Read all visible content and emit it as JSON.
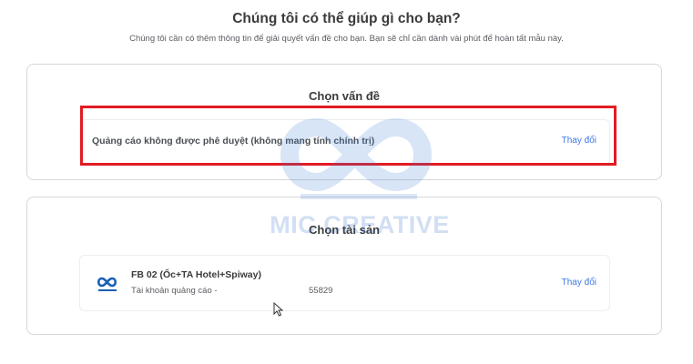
{
  "header": {
    "title": "Chúng tôi có thể giúp gì cho bạn?",
    "subtitle": "Chúng tôi cần có thêm thông tin để giải quyết vấn đề cho bạn. Bạn sẽ chỉ cần dành vài phút để hoàn tất mẫu này."
  },
  "issue_section": {
    "title": "Chọn vấn đề",
    "selected_issue": "Quảng cáo không được phê duyệt (không mang tính chính trị)",
    "change_label": "Thay đổi"
  },
  "asset_section": {
    "title": "Chọn tài sản",
    "asset_name": "FB 02 (Ốc+TA Hotel+Spiway)",
    "asset_type": "Tài khoản quảng cáo -",
    "asset_id_partial": "55829",
    "change_label": "Thay đổi"
  },
  "watermark": {
    "text": "MIC CREATIVE"
  },
  "colors": {
    "highlight": "#e21b23",
    "link": "#3b78e7",
    "watermark": "#3a7bd5"
  },
  "icons": {
    "asset_logo": "mic-creative-logo-icon",
    "cursor": "mouse-pointer-icon"
  }
}
